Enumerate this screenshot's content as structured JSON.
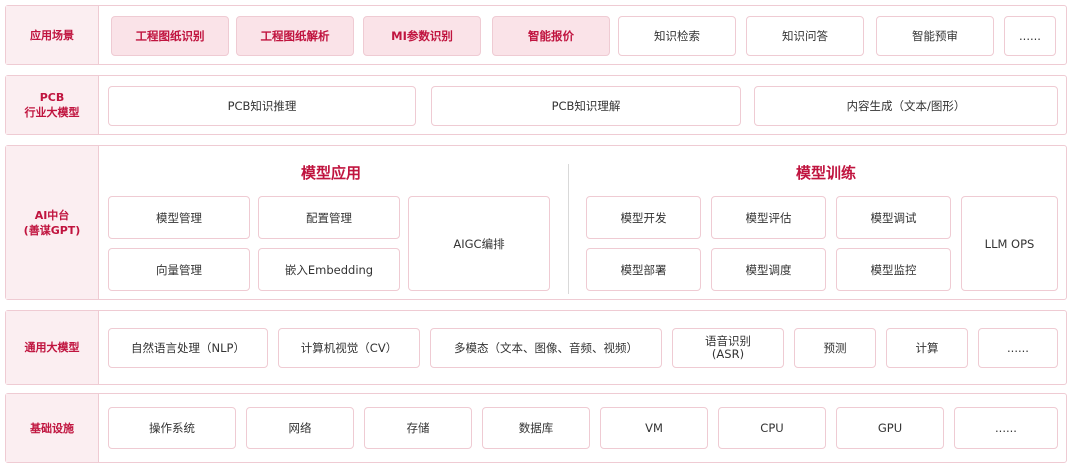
{
  "rows": {
    "scenarios": {
      "label": "应用场景",
      "items": [
        "工程图纸识别",
        "工程图纸解析",
        "MI参数识别",
        "智能报价",
        "知识检索",
        "知识问答",
        "智能预审",
        "......"
      ]
    },
    "pcb_model": {
      "label_line1": "PCB",
      "label_line2": "行业大模型",
      "items": [
        "PCB知识推理",
        "PCB知识理解",
        "内容生成（文本/图形）"
      ]
    },
    "ai_platform": {
      "label_line1": "AI中台",
      "label_line2": "(善谋GPT)",
      "application": {
        "title": "模型应用",
        "items": [
          "模型管理",
          "配置管理",
          "向量管理",
          "嵌入Embedding"
        ],
        "aigc": "AIGC编排"
      },
      "training": {
        "title": "模型训练",
        "items": [
          "模型开发",
          "模型评估",
          "模型调试",
          "模型部署",
          "模型调度",
          "模型监控"
        ],
        "llmops": "LLM OPS"
      }
    },
    "general_model": {
      "label": "通用大模型",
      "items": [
        "自然语言处理（NLP）",
        "计算机视觉（CV）",
        "多模态（文本、图像、音频、视频）"
      ],
      "asr_line1": "语音识别",
      "asr_line2": "(ASR)",
      "items_after": [
        "预测",
        "计算",
        "......"
      ]
    },
    "infrastructure": {
      "label": "基础设施",
      "items": [
        "操作系统",
        "网络",
        "存储",
        "数据库",
        "VM",
        "CPU",
        "GPU",
        "......"
      ]
    }
  }
}
